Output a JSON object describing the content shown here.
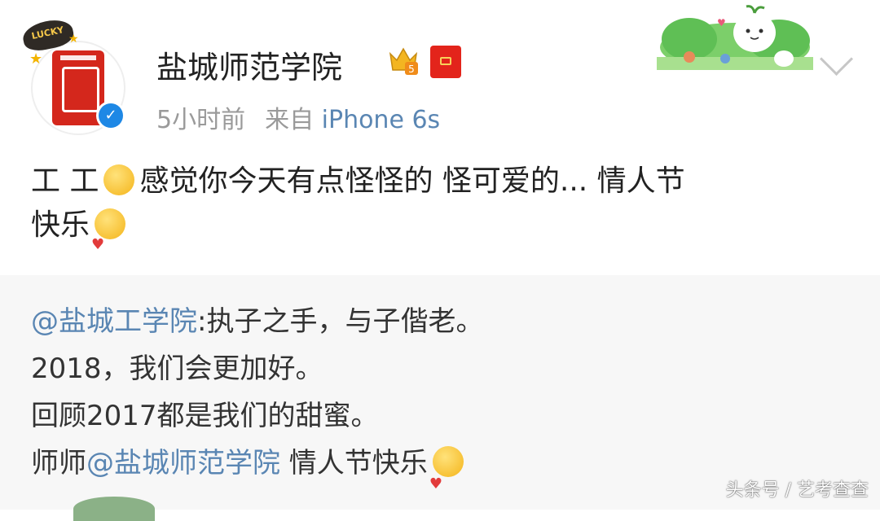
{
  "post": {
    "username": "盐城师范学院",
    "time": "5小时前",
    "source_prefix": "来自",
    "device": "iPhone 6s",
    "avatar_tag": "LUCKY",
    "vip_level": "5",
    "text_line1_a": "工 工",
    "text_line1_b": "感觉你今天有点怪怪的 怪可爱的... 情人节",
    "text_line2": "快乐"
  },
  "repost": {
    "mention1": "@盐城工学院",
    "line1_rest": ":执子之手，与子偕老。",
    "line2": "2018，我们会更加好。",
    "line3": "回顾2017都是我们的甜蜜。",
    "line4_prefix": "师师",
    "mention2": "@盐城师范学院",
    "line4_rest": " 情人节快乐"
  },
  "watermark": "头条号 / 艺考查查",
  "colors": {
    "link": "#5a86b3",
    "meta": "#9a9a9a",
    "text": "#222222",
    "verified": "#1e88e5",
    "redpack": "#e3241b"
  },
  "icons": [
    "verified-icon",
    "vip-crown-icon",
    "red-packet-icon",
    "chevron-down-icon",
    "smile-emoji-icon",
    "shy-emoji-icon"
  ]
}
